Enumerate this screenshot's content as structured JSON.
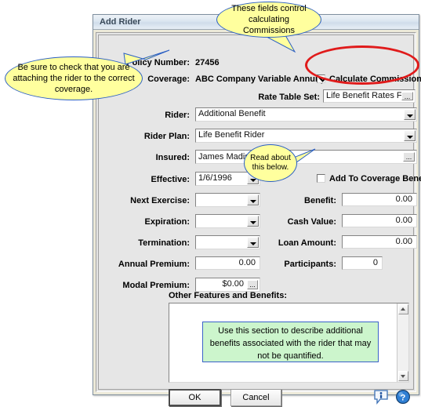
{
  "window": {
    "title": "Add Rider"
  },
  "form": {
    "policy_number": {
      "label": "Policy Number:",
      "value": "27456"
    },
    "coverage": {
      "label": "Coverage:",
      "value": "ABC Company Variable Annuity"
    },
    "calculate_commissions": {
      "label": "Calculate Commissions",
      "checked": true
    },
    "rate_table_set": {
      "label": "Rate Table Set:",
      "value": "Life Benefit Rates For",
      "button": "..."
    },
    "rider": {
      "label": "Rider:",
      "value": "Additional Benefit"
    },
    "rider_plan": {
      "label": "Rider Plan:",
      "value": "Life Benefit Rider"
    },
    "insured": {
      "label": "Insured:",
      "value": "James Madison",
      "button": "..."
    },
    "effective": {
      "label": "Effective:",
      "value": "1/6/1996"
    },
    "next_exercise": {
      "label": "Next Exercise:",
      "value": ""
    },
    "expiration": {
      "label": "Expiration:",
      "value": ""
    },
    "termination": {
      "label": "Termination:",
      "value": ""
    },
    "annual_premium": {
      "label": "Annual Premium:",
      "value": "0.00"
    },
    "modal_premium": {
      "label": "Modal Premium:",
      "value": "$0.00",
      "button": "..."
    },
    "add_to_coverage_benefit": {
      "label": "Add To Coverage Benefit",
      "checked": false
    },
    "benefit": {
      "label": "Benefit:",
      "value": "0.00"
    },
    "cash_value": {
      "label": "Cash Value:",
      "value": "0.00"
    },
    "loan_amount": {
      "label": "Loan Amount:",
      "value": "0.00"
    },
    "participants": {
      "label": "Participants:",
      "value": "0"
    },
    "other_features": {
      "label": "Other Features and Benefits:",
      "value": ""
    }
  },
  "buttons": {
    "ok": "OK",
    "cancel": "Cancel",
    "info_icon": "info-icon",
    "help_icon": "help-icon"
  },
  "annotations": {
    "commissions": "These fields control calculating Commissions",
    "coverage": "Be sure to check that you are attaching the rider to the correct coverage.",
    "read_below": "Read about this below.",
    "green_note": "Use this section to describe additional benefits associated with the rider that may not be quantified."
  },
  "colors": {
    "callout_fill": "#ffff9e",
    "callout_border": "#2b5fc4",
    "highlight_ellipse": "#e01b1b",
    "green_note_fill": "#ccf5cc",
    "dialog_bg": "#e6e6e6"
  }
}
